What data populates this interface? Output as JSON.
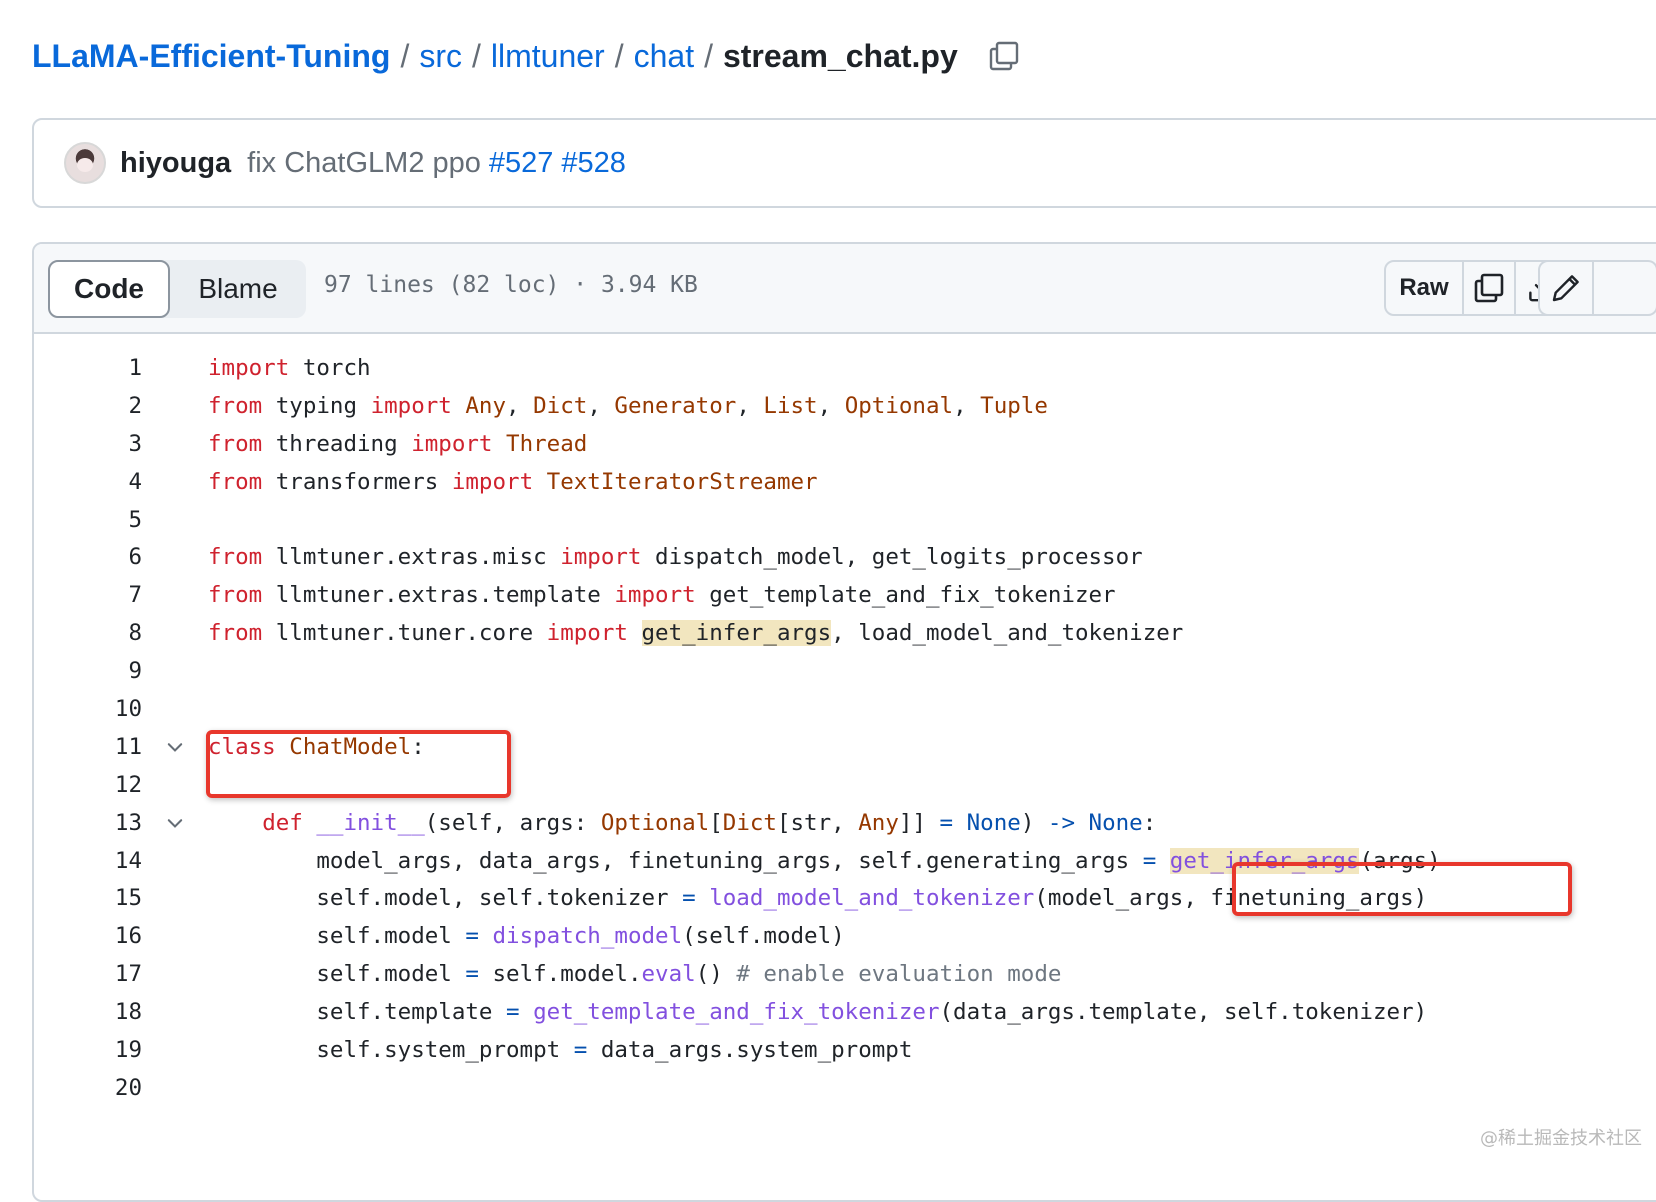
{
  "breadcrumb": {
    "repo": "LLaMA-Efficient-Tuning",
    "dirs": [
      "src",
      "llmtuner",
      "chat"
    ],
    "separator": "/",
    "file": "stream_chat.py",
    "copy_icon": "copy-icon"
  },
  "commit": {
    "author": "hiyouga",
    "message": "fix ChatGLM2 ppo",
    "refs": [
      "#527",
      "#528"
    ]
  },
  "file_header": {
    "tabs": [
      "Code",
      "Blame"
    ],
    "active_tab": "Code",
    "info": "97 lines (82 loc) · 3.94 KB",
    "raw_label": "Raw",
    "icons": [
      "copy-icon",
      "download-icon",
      "pencil-icon"
    ]
  },
  "code": {
    "line_numbers": [
      "1",
      "2",
      "3",
      "4",
      "5",
      "6",
      "7",
      "8",
      "9",
      "10",
      "11",
      "12",
      "13",
      "14",
      "15",
      "16",
      "17",
      "18",
      "19",
      "20"
    ],
    "fold_lines": [
      "11",
      "13"
    ],
    "lines": [
      "import torch",
      "from typing import Any, Dict, Generator, List, Optional, Tuple",
      "from threading import Thread",
      "from transformers import TextIteratorStreamer",
      "",
      "from llmtuner.extras.misc import dispatch_model, get_logits_processor",
      "from llmtuner.extras.template import get_template_and_fix_tokenizer",
      "from llmtuner.tuner.core import get_infer_args, load_model_and_tokenizer",
      "",
      "",
      "class ChatModel:",
      "",
      "    def __init__(self, args: Optional[Dict[str, Any]] = None) -> None:",
      "        model_args, data_args, finetuning_args, self.generating_args = get_infer_args(args)",
      "        self.model, self.tokenizer = load_model_and_tokenizer(model_args, finetuning_args)",
      "        self.model = dispatch_model(self.model)",
      "        self.model = self.model.eval() # enable evaluation mode",
      "        self.template = get_template_and_fix_tokenizer(data_args.template, self.tokenizer)",
      "        self.system_prompt = data_args.system_prompt",
      ""
    ],
    "highlighted_symbol": "get_infer_args"
  },
  "annotations": [
    "class ChatModel:",
    "get_infer_args(args)"
  ],
  "watermark": "@稀土掘金技术社区",
  "colors": {
    "link": "#0969da",
    "keyword": "#cf222e",
    "class": "#953800",
    "function": "#8250df",
    "operator": "#0550ae",
    "comment": "#6e7781",
    "highlight": "#f2e6bf",
    "annotation": "#e8372c"
  }
}
